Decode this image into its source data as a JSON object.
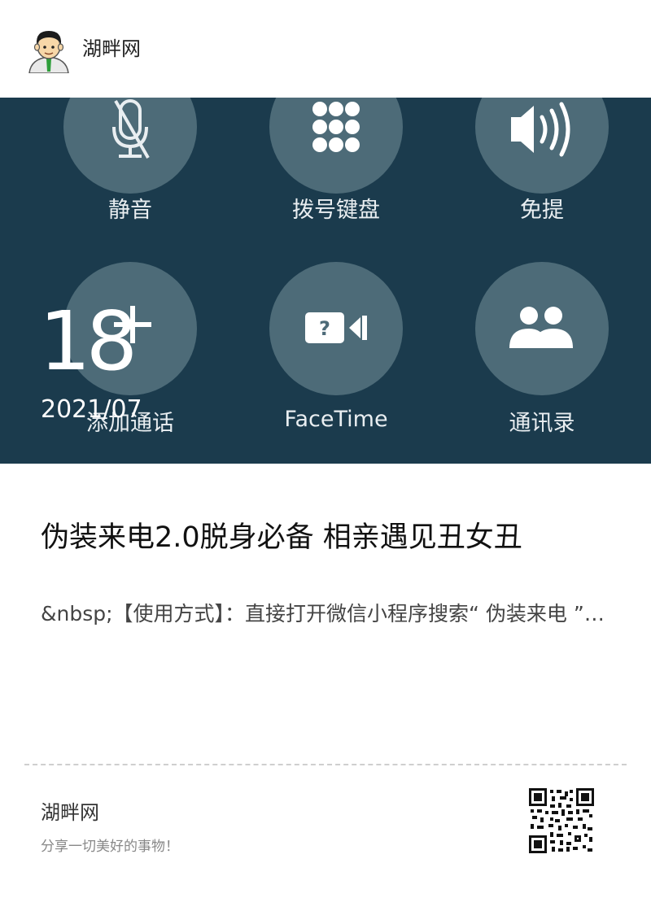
{
  "header": {
    "site_name": "湖畔网",
    "avatar_icon": "user-avatar-icon"
  },
  "hero": {
    "background": "#1b3b4d",
    "buttons": [
      {
        "label": "静音",
        "icon": "mic-muted-icon"
      },
      {
        "label": "拨号键盘",
        "icon": "keypad-icon"
      },
      {
        "label": "免提",
        "icon": "speaker-icon"
      },
      {
        "label": "添加通话",
        "icon": "add-call-icon"
      },
      {
        "label": "FaceTime",
        "icon": "facetime-icon"
      },
      {
        "label": "通讯录",
        "icon": "contacts-icon"
      }
    ],
    "date_day": "18",
    "date_year_month": "2021/07"
  },
  "article": {
    "title": "伪装来电2.0脱身必备 相亲遇见丑女丑",
    "excerpt": "&nbsp;【使用方式】：直接打开微信小程序搜索“ 伪装来电 ”…"
  },
  "footer": {
    "site_name": "湖畔网",
    "slogan": "分享一切美好的事物！",
    "qr_icon": "qr-code-icon"
  }
}
